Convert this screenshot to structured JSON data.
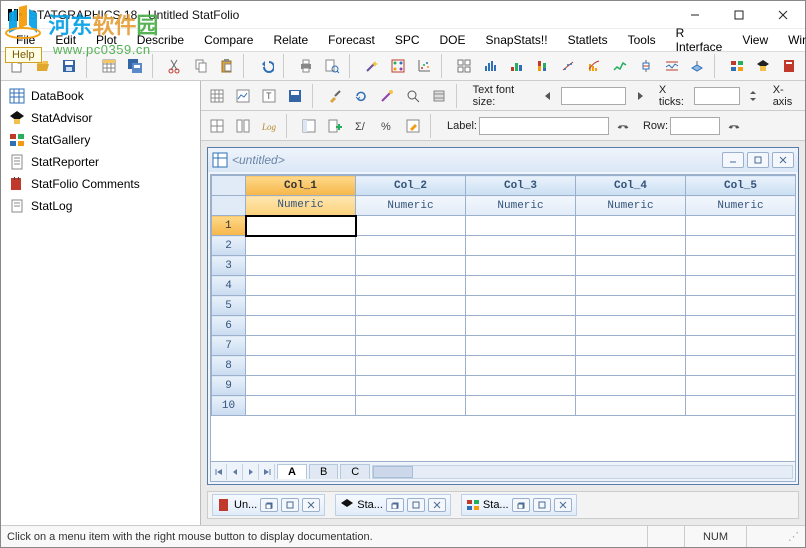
{
  "titlebar": {
    "title": "STATGRAPHICS 18 - Untitled StatFolio"
  },
  "menu": [
    "File",
    "Edit",
    "Plot",
    "Describe",
    "Compare",
    "Relate",
    "Forecast",
    "SPC",
    "DOE",
    "SnapStats!!",
    "Statlets",
    "Tools",
    "R Interface",
    "View",
    "Window"
  ],
  "help_badge": "Help",
  "watermark": {
    "brand": "河东软件园",
    "url": "www.pc0359.cn"
  },
  "tb2": {
    "textfont_label": "Text font size:",
    "xticks_label": "X ticks:",
    "xaxis_label": "X-axis",
    "label_label": "Label:",
    "row_label": "Row:"
  },
  "nav": [
    "DataBook",
    "StatAdvisor",
    "StatGallery",
    "StatReporter",
    "StatFolio Comments",
    "StatLog"
  ],
  "doc": {
    "title": "<untitled>",
    "columns": [
      "Col_1",
      "Col_2",
      "Col_3",
      "Col_4",
      "Col_5"
    ],
    "types": [
      "Numeric",
      "Numeric",
      "Numeric",
      "Numeric",
      "Numeric"
    ],
    "rows": [
      1,
      2,
      3,
      4,
      5,
      6,
      7,
      8,
      9,
      10
    ],
    "tabs": [
      "A",
      "B",
      "C"
    ]
  },
  "wintabs": [
    {
      "label": "Un..."
    },
    {
      "label": "Sta..."
    },
    {
      "label": "Sta..."
    }
  ],
  "status": {
    "msg": "Click on a menu item with the right mouse button to display documentation.",
    "num": "NUM"
  }
}
